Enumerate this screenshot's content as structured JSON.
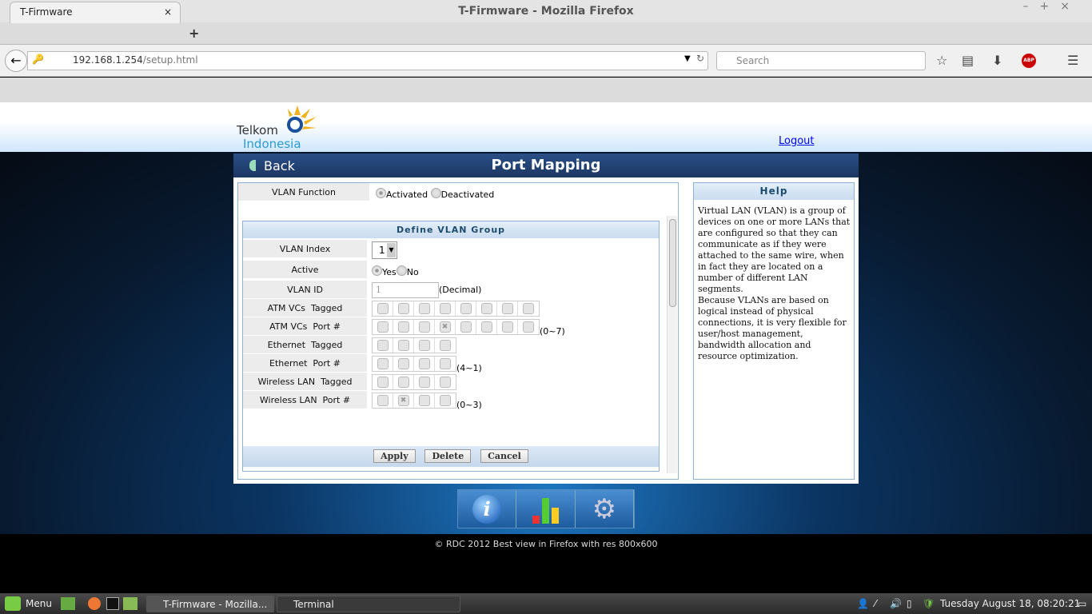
{
  "window": {
    "title": "T-Firmware - Mozilla Firefox",
    "controls": "–+×"
  },
  "browser": {
    "tab_label": "T-Firmware",
    "tab_close": "×",
    "new_tab": "+",
    "url_host": "192.168.1.254",
    "url_path": "/setup.html",
    "search_placeholder": "Search"
  },
  "page": {
    "logo": {
      "line1": "Telkom",
      "line2": "Indonesia"
    },
    "logout": "Logout",
    "back": "Back",
    "title": "Port Mapping",
    "vlan_function": {
      "label": "VLAN Function",
      "options": [
        "Activated",
        "Deactivated"
      ],
      "selected": "Activated"
    },
    "group": {
      "title": "Define VLAN Group",
      "vlan_index": {
        "label": "VLAN Index",
        "value": "1"
      },
      "active": {
        "label": "Active",
        "options": [
          "Yes",
          "No"
        ],
        "selected": "Yes"
      },
      "vlan_id": {
        "label": "VLAN ID",
        "value": "1",
        "suffix": "(Decimal)"
      },
      "rows": [
        {
          "label": "ATM VCs  Tagged",
          "checked": [
            0,
            0,
            0,
            0,
            0,
            0,
            0,
            0
          ],
          "suffix": ""
        },
        {
          "label": "ATM VCs  Port #",
          "checked": [
            0,
            0,
            0,
            1,
            0,
            0,
            0,
            0
          ],
          "suffix": "(0~7)"
        },
        {
          "label": "Ethernet  Tagged",
          "checked": [
            0,
            0,
            0,
            0
          ],
          "suffix": ""
        },
        {
          "label": "Ethernet  Port #",
          "checked": [
            0,
            0,
            0,
            0
          ],
          "suffix": "(4~1)"
        },
        {
          "label": "Wireless LAN  Tagged",
          "checked": [
            0,
            0,
            0,
            0
          ],
          "suffix": ""
        },
        {
          "label": "Wireless LAN  Port #",
          "checked": [
            0,
            1,
            0,
            0
          ],
          "suffix": "(0~3)"
        }
      ],
      "buttons": {
        "apply": "Apply",
        "delete": "Delete",
        "cancel": "Cancel"
      }
    },
    "help": {
      "title": "Help",
      "text": "Virtual LAN (VLAN) is a group of devices on one or more LANs that are configured so that they can communicate as if they were attached to the same wire, when in fact they are located on a number of different LAN segments.\nBecause VLANs are based on logical instead of physical connections, it is very flexible for user/host management, bandwidth allocation and resource optimization."
    },
    "footer": "© RDC 2012 Best view in Firefox with res 800x600"
  },
  "taskbar": {
    "menu": "Menu",
    "tasks": [
      "T-Firmware - Mozilla...",
      "Terminal"
    ],
    "clock": "Tuesday August 18, 08:20:21"
  },
  "colors": {
    "header_blue": "#1b3663",
    "link": "#0000ee",
    "accent": "#1d4c6e"
  }
}
